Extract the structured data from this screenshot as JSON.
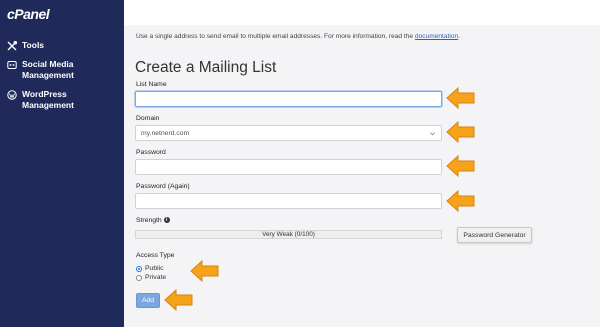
{
  "sidebar": {
    "logo": "cPanel",
    "items": [
      {
        "label": "Tools",
        "icon": "tools-icon"
      },
      {
        "label": "Social Media\nManagement",
        "icon": "social-media-icon"
      },
      {
        "label": "WordPress\nManagement",
        "icon": "wordpress-icon"
      }
    ]
  },
  "intro": {
    "text": "Use a single address to send email to multiple email addresses. For more information, read the ",
    "link": "documentation",
    "suffix": "."
  },
  "title": "Create a Mailing List",
  "form": {
    "list_name_label": "List Name",
    "list_name_value": "",
    "domain_label": "Domain",
    "domain_value": "my.netnerd.com",
    "password_label": "Password",
    "password_value": "",
    "password_again_label": "Password (Again)",
    "password_again_value": "",
    "strength_label": "Strength",
    "strength_info_icon": "i",
    "strength_value": "Very Weak (0/100)",
    "password_generator_label": "Password Generator",
    "access_type_label": "Access Type",
    "access_options": [
      {
        "label": "Public",
        "checked": true
      },
      {
        "label": "Private",
        "checked": false
      }
    ],
    "add_label": "Add"
  },
  "colors": {
    "sidebar": "#1f2a5a",
    "arrow": "#f7a21b",
    "add_button": "#7aa7df",
    "link": "#2b5fc4"
  }
}
